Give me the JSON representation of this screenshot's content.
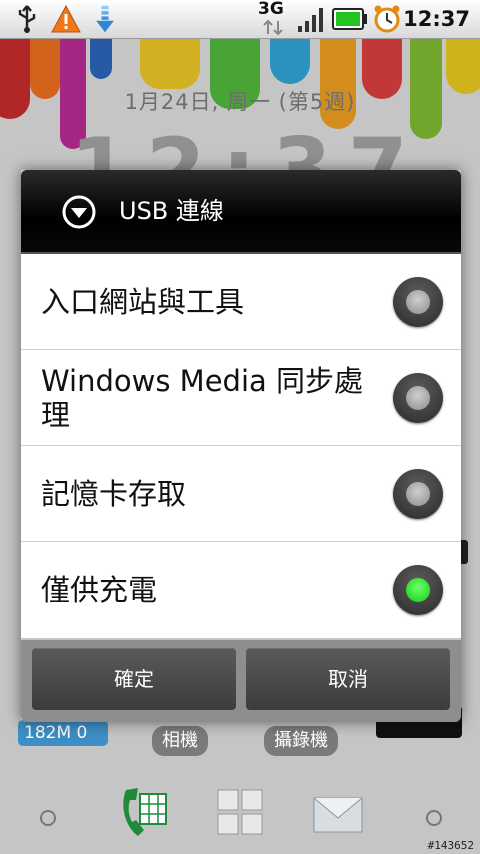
{
  "status_bar": {
    "icons": [
      "usb-icon",
      "warning-icon",
      "download-icon"
    ],
    "network_type": "3G",
    "signal_icon": "signal-bars-icon",
    "battery_icon": "battery-icon",
    "alarm_icon": "alarm-clock-icon",
    "time": "12:37"
  },
  "home": {
    "date": "1月24日, 周一 (第5週)",
    "clock": "12:37",
    "memory_widget": "182M  0",
    "app_labels": [
      "相機",
      "攝錄機"
    ],
    "dock_icons": [
      "phone-icon",
      "app-grid-icon",
      "mail-icon"
    ]
  },
  "dialog": {
    "title": "USB 連線",
    "title_icon": "dropdown-circle-icon",
    "options": [
      {
        "label": "入口網站與工具",
        "selected": false
      },
      {
        "label": "Windows Media 同步處理",
        "selected": false
      },
      {
        "label": "記憶卡存取",
        "selected": false
      },
      {
        "label": "僅供充電",
        "selected": true
      }
    ],
    "ok_label": "確定",
    "cancel_label": "取消"
  },
  "watermark": "#143652",
  "colors": {
    "selected_radio": "#12cc12",
    "dialog_title_bg": "#000000",
    "button_bg": "#4a4a4a"
  }
}
